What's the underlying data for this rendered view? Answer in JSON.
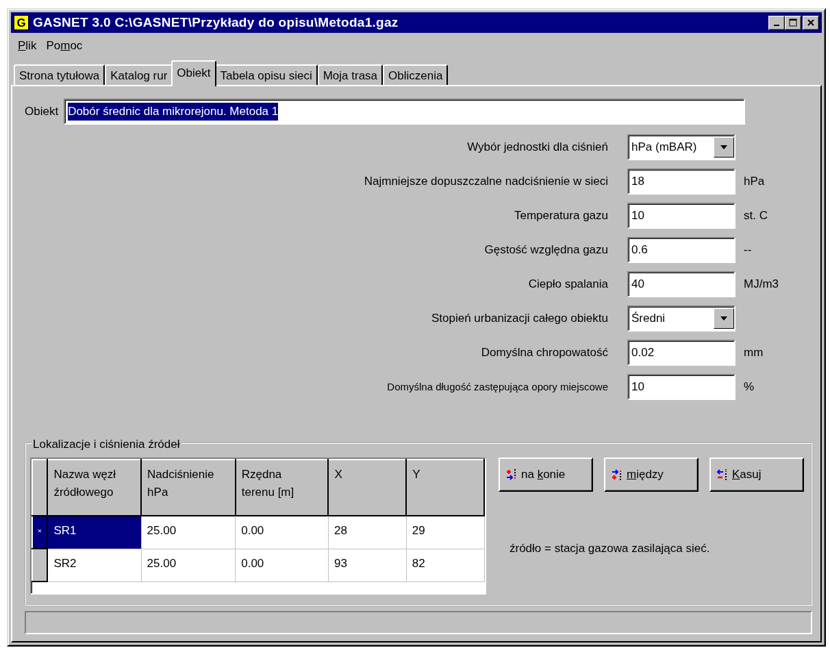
{
  "window": {
    "title": "GASNET 3.0 C:\\GASNET\\Przykłady do opisu\\Metoda1.gaz",
    "app_icon_letter": "G"
  },
  "menu": [
    {
      "key": "P",
      "post": "lik"
    },
    {
      "pre": "Po",
      "key": "m",
      "post": "oc"
    }
  ],
  "tabs": [
    {
      "label": "Strona tytułowa",
      "selected": false
    },
    {
      "label": "Katalog rur",
      "selected": false
    },
    {
      "label": "Obiekt",
      "selected": true
    },
    {
      "label": "Tabela opisu sieci",
      "selected": false
    },
    {
      "label": "Moja trasa",
      "selected": false
    },
    {
      "label": "Obliczenia",
      "selected": false
    }
  ],
  "object": {
    "label": "Obiekt",
    "value": "Dobór średnic dla mikrorejonu. Metoda 1",
    "text_selected": true
  },
  "fields": [
    {
      "kind": "select",
      "label": "Wybór jednostki dla ciśnień",
      "value": "hPa (mBAR)"
    },
    {
      "kind": "input",
      "label": "Najmniejsze dopuszczalne nadciśnienie w sieci",
      "value": "18",
      "unit": "hPa"
    },
    {
      "kind": "input",
      "label": "Temperatura gazu",
      "value": "10",
      "unit": "st. C"
    },
    {
      "kind": "input",
      "label": "Gęstość względna gazu",
      "value": "0.6",
      "unit": "--"
    },
    {
      "kind": "input",
      "label": "Ciepło spalania",
      "value": "40",
      "unit": "MJ/m3"
    },
    {
      "kind": "select",
      "label": "Stopień urbanizacji  całego obiektu",
      "value": "Średni"
    },
    {
      "kind": "input",
      "label": "Domyślna chropowatość",
      "value": "0.02",
      "unit": "mm"
    },
    {
      "kind": "input",
      "label": "Domyślna długość zastępująca opory  miejscowe",
      "value": "10",
      "unit": "%",
      "small": true
    }
  ],
  "sources": {
    "title": "Lokalizacje i ciśnienia źródeł",
    "table": {
      "columns": [
        "Nazwa węzł\nźródłowego",
        "Nadciśnienie\nhPa",
        "Rzędna\nterenu [m]",
        "X",
        "Y"
      ],
      "rows": [
        {
          "selected": true,
          "cells": [
            "SR1",
            "25.00",
            "0.00",
            "28",
            "29"
          ]
        },
        {
          "selected": false,
          "cells": [
            "SR2",
            "25.00",
            "0.00",
            "93",
            "82"
          ]
        }
      ]
    },
    "buttons": [
      {
        "kind": "append",
        "pre": "na ",
        "key": "k",
        "post": "onie"
      },
      {
        "kind": "insert",
        "key": "m",
        "post": "iędzy"
      },
      {
        "kind": "delete",
        "key": "K",
        "post": "asuj"
      }
    ],
    "note": "źródło = stacja gazowa zasilająca sieć."
  }
}
